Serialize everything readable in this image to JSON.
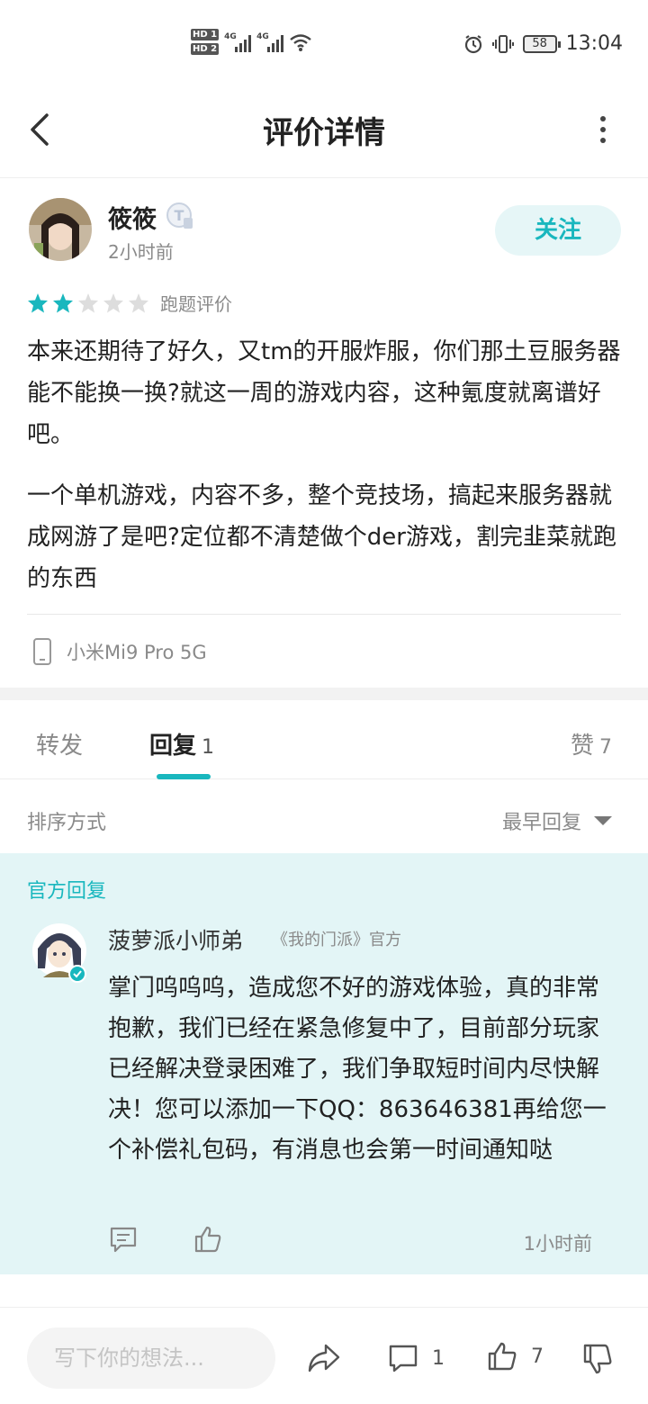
{
  "status_bar": {
    "hd1": "HD 1",
    "hd2": "HD 2",
    "net1": "4G",
    "net2": "4G",
    "battery": "58",
    "time": "13:04"
  },
  "header": {
    "title": "评价详情"
  },
  "review": {
    "user_name": "筱筱",
    "level_badge": "T",
    "time": "2小时前",
    "follow_label": "关注",
    "rating": 2,
    "rating_max": 5,
    "rating_label": "跑题评价",
    "paragraphs": [
      "本来还期待了好久，又tm的开服炸服，你们那土豆服务器能不能换一换?就这一周的游戏内容，这种氪度就离谱好吧。",
      "一个单机游戏，内容不多，整个竞技场，搞起来服务器就成网游了是吧?定位都不清楚做个der游戏，割完韭菜就跑的东西"
    ],
    "device": "小米Mi9 Pro 5G"
  },
  "tabs": {
    "repost": "转发",
    "reply": "回复",
    "reply_count": "1",
    "likes": "赞",
    "likes_count": "7"
  },
  "sort": {
    "label": "排序方式",
    "selected": "最早回复"
  },
  "official_reply": {
    "section_label": "官方回复",
    "name": "菠萝派小师弟",
    "tag": "《我的门派》官方",
    "text": "掌门呜呜呜，造成您不好的游戏体验，真的非常抱歉，我们已经在紧急修复中了，目前部分玩家已经解决登录困难了，我们争取短时间内尽快解决！您可以添加一下QQ：863646381再给您一个补偿礼包码，有消息也会第一时间通知哒",
    "time": "1小时前"
  },
  "bottom_bar": {
    "input_placeholder": "写下你的想法...",
    "comment_count": "1",
    "like_count": "7"
  },
  "colors": {
    "accent": "#19b7be",
    "official_bg": "#e3f5f6",
    "star_on": "#19b7be",
    "star_off": "#dddddd"
  }
}
